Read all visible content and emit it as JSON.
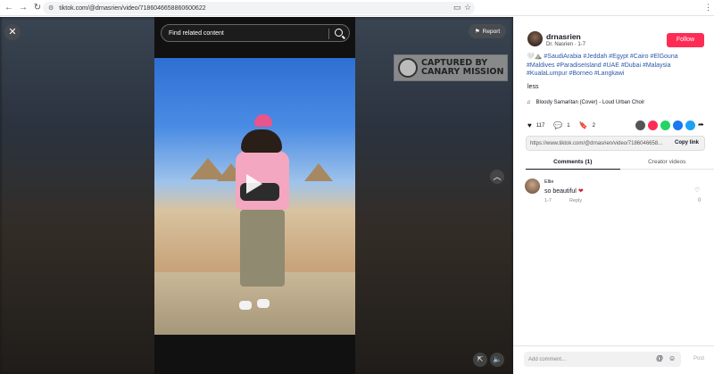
{
  "browser": {
    "url": "tiktok.com/@drnasrien/video/7186046658860600622"
  },
  "video": {
    "search_placeholder": "Find related content",
    "report_label": "Report",
    "watermark_line1": "CAPTURED BY",
    "watermark_line2": "CANARY MISSION"
  },
  "post": {
    "username": "drnasrien",
    "display_name": "Dr. Nasrien · 1-7",
    "follow_label": "Follow",
    "description_prefix": "🤍⛰️",
    "description_tags": "#SaudiArabia #Jeddah #Egypt #Cairo #ElGouna #Maldives #ParadiseIsland #UAE #Dubai #Malaysia #KualaLumpur #Borneo #Langkawi",
    "less_label": "less",
    "music": "Bloody Samaritan (Cover) - Loud Urban Choir",
    "likes": "117",
    "comments": "1",
    "saves": "2",
    "link": "https://www.tiktok.com/@drnasrien/video/7186046658...",
    "copy_label": "Copy link"
  },
  "tabs": [
    {
      "label": "Comments (1)",
      "active": true
    },
    {
      "label": "Creator videos",
      "active": false
    }
  ],
  "comment": {
    "author": "Ellie",
    "text": "so beautiful",
    "date": "1-7",
    "reply_label": "Reply",
    "likes": "0"
  },
  "composer": {
    "placeholder": "Add comment...",
    "post_label": "Post"
  },
  "colors": {
    "accent": "#fe2c55",
    "hashtag": "#2b5aa8"
  }
}
